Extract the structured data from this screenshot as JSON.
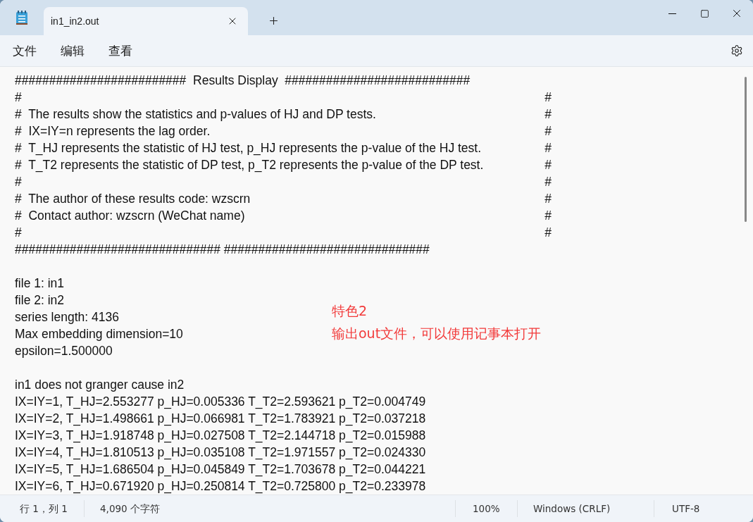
{
  "window": {
    "tab_title": "in1_in2.out"
  },
  "menu": [
    "文件",
    "编辑",
    "查看"
  ],
  "banner": [
    {
      "left": "#########################  Results Display  ###########################"
    },
    {
      "left": "#",
      "right": "#"
    },
    {
      "left": "#  The results show the statistics and p-values of HJ and DP tests.",
      "right": "#"
    },
    {
      "left": "#  IX=IY=n represents the lag order.",
      "right": "#"
    },
    {
      "left": "#  T_HJ represents the statistic of HJ test, p_HJ represents the p-value of the HJ test.",
      "right": "#"
    },
    {
      "left": "#  T_T2 represents the statistic of DP test, p_T2 represents the p-value of the DP test.",
      "right": "#"
    },
    {
      "left": "#",
      "right": "#"
    },
    {
      "left": "#  The author of these results code: wzscrn",
      "right": "#"
    },
    {
      "left": "#  Contact author: wzscrn (WeChat name)",
      "right": "#"
    },
    {
      "left": "#",
      "right": "#"
    },
    {
      "left": "############################## ##############################"
    }
  ],
  "lines": [
    {
      "kind": "blank"
    },
    {
      "kind": "text",
      "text": "file 1: in1"
    },
    {
      "kind": "text",
      "text": "file 2: in2"
    },
    {
      "kind": "text",
      "text": "series length: 4136"
    },
    {
      "kind": "text",
      "text": "Max embedding dimension=10"
    },
    {
      "kind": "text",
      "text": "epsilon=1.500000"
    },
    {
      "kind": "blank"
    },
    {
      "kind": "text",
      "text": "in1 does not granger cause in2"
    },
    {
      "kind": "text",
      "text": "IX=IY=1, T_HJ=2.553277 p_HJ=0.005336 T_T2=2.593621 p_T2=0.004749"
    },
    {
      "kind": "text",
      "text": "IX=IY=2, T_HJ=1.498661 p_HJ=0.066981 T_T2=1.783921 p_T2=0.037218"
    },
    {
      "kind": "text",
      "text": "IX=IY=3, T_HJ=1.918748 p_HJ=0.027508 T_T2=2.144718 p_T2=0.015988"
    },
    {
      "kind": "text",
      "text": "IX=IY=4, T_HJ=1.810513 p_HJ=0.035108 T_T2=1.971557 p_T2=0.024330"
    },
    {
      "kind": "text",
      "text": "IX=IY=5, T_HJ=1.686504 p_HJ=0.045849 T_T2=1.703678 p_T2=0.044221"
    },
    {
      "kind": "text",
      "text": "IX=IY=6, T_HJ=0.671920 p_HJ=0.250814 T_T2=0.725800 p_T2=0.233978"
    }
  ],
  "annotation": [
    "特色2",
    "输出out文件，可以使用记事本打开"
  ],
  "status_bar": {
    "position": "行 1，列 1",
    "characters": "4,090 个字符",
    "zoom": "100%",
    "line_ending": "Windows (CRLF)",
    "encoding": "UTF-8"
  }
}
